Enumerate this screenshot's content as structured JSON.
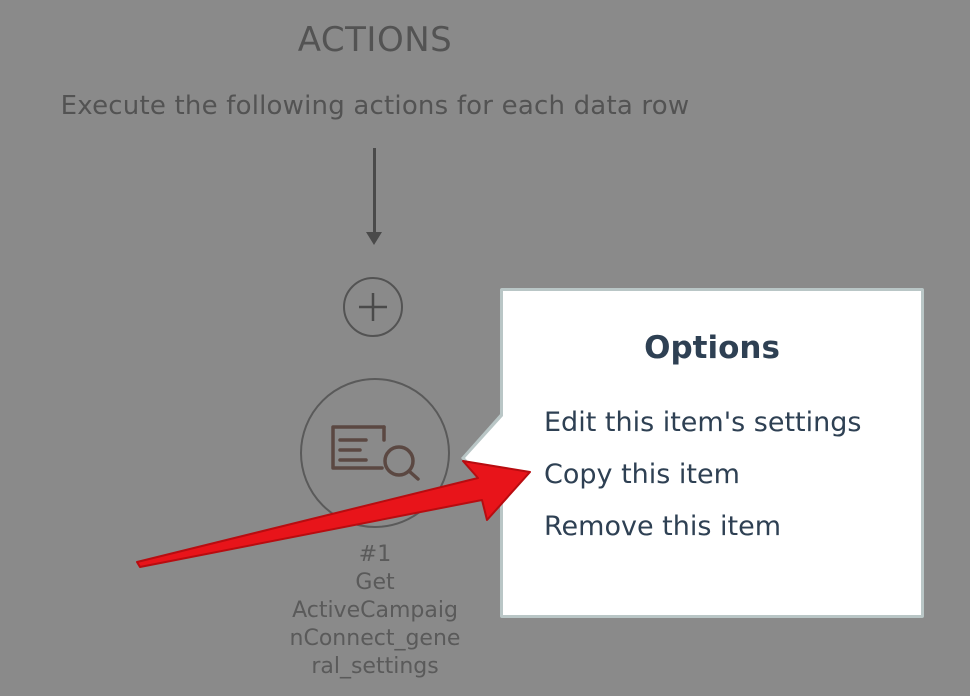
{
  "actions_section": {
    "title": "ACTIONS",
    "description": "Execute the following actions for each data row"
  },
  "add_button": {
    "icon": "plus-icon"
  },
  "action_node": {
    "icon": "search-list-icon",
    "accent_color": "#a8857a",
    "label_lines": [
      "#1",
      "Get",
      "ActiveCampaig",
      "nConnect_gene",
      "ral_settings"
    ]
  },
  "options_popover": {
    "title": "Options",
    "items": [
      {
        "label": "Edit this item's settings"
      },
      {
        "label": "Copy this item"
      },
      {
        "label": "Remove this item"
      }
    ],
    "border_color": "#b9c6c6",
    "text_color": "#2e4053"
  },
  "annotation": {
    "icon": "red-arrow-pointer",
    "color": "#e8141a"
  }
}
